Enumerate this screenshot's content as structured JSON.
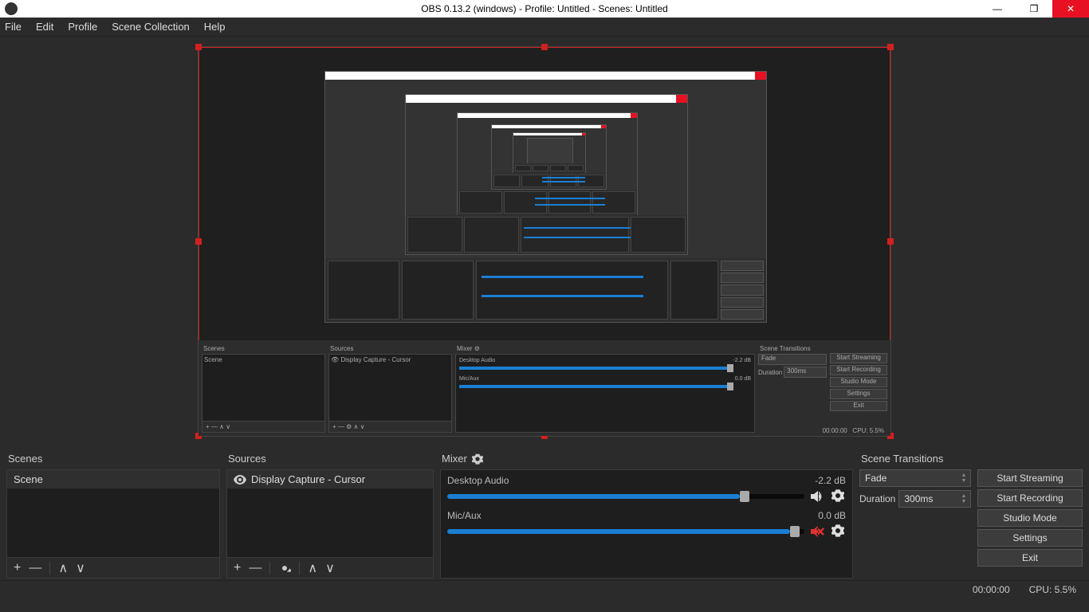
{
  "window": {
    "title": "OBS 0.13.2 (windows) - Profile: Untitled - Scenes: Untitled",
    "minimize": "—",
    "maximize": "❐",
    "close": "✕"
  },
  "menu": {
    "file": "File",
    "edit": "Edit",
    "profile": "Profile",
    "scene_collection": "Scene Collection",
    "help": "Help"
  },
  "panels": {
    "scenes": {
      "title": "Scenes",
      "item": "Scene"
    },
    "sources": {
      "title": "Sources",
      "item": "Display Capture - Cursor"
    },
    "mixer": {
      "title": "Mixer",
      "ch1": {
        "name": "Desktop Audio",
        "level": "-2.2 dB"
      },
      "ch2": {
        "name": "Mic/Aux",
        "level": "0.0 dB"
      }
    },
    "transitions": {
      "title": "Scene Transitions",
      "mode": "Fade",
      "duration_label": "Duration",
      "duration_value": "300ms"
    },
    "controls": {
      "start_streaming": "Start Streaming",
      "start_recording": "Start Recording",
      "studio_mode": "Studio Mode",
      "settings": "Settings",
      "exit": "Exit"
    }
  },
  "toolbar_glyphs": {
    "add": "+",
    "remove": "—",
    "up": "∧",
    "down": "∨",
    "gear": "⚙"
  },
  "status": {
    "time": "00:00:00",
    "cpu": "CPU: 5.5%"
  }
}
